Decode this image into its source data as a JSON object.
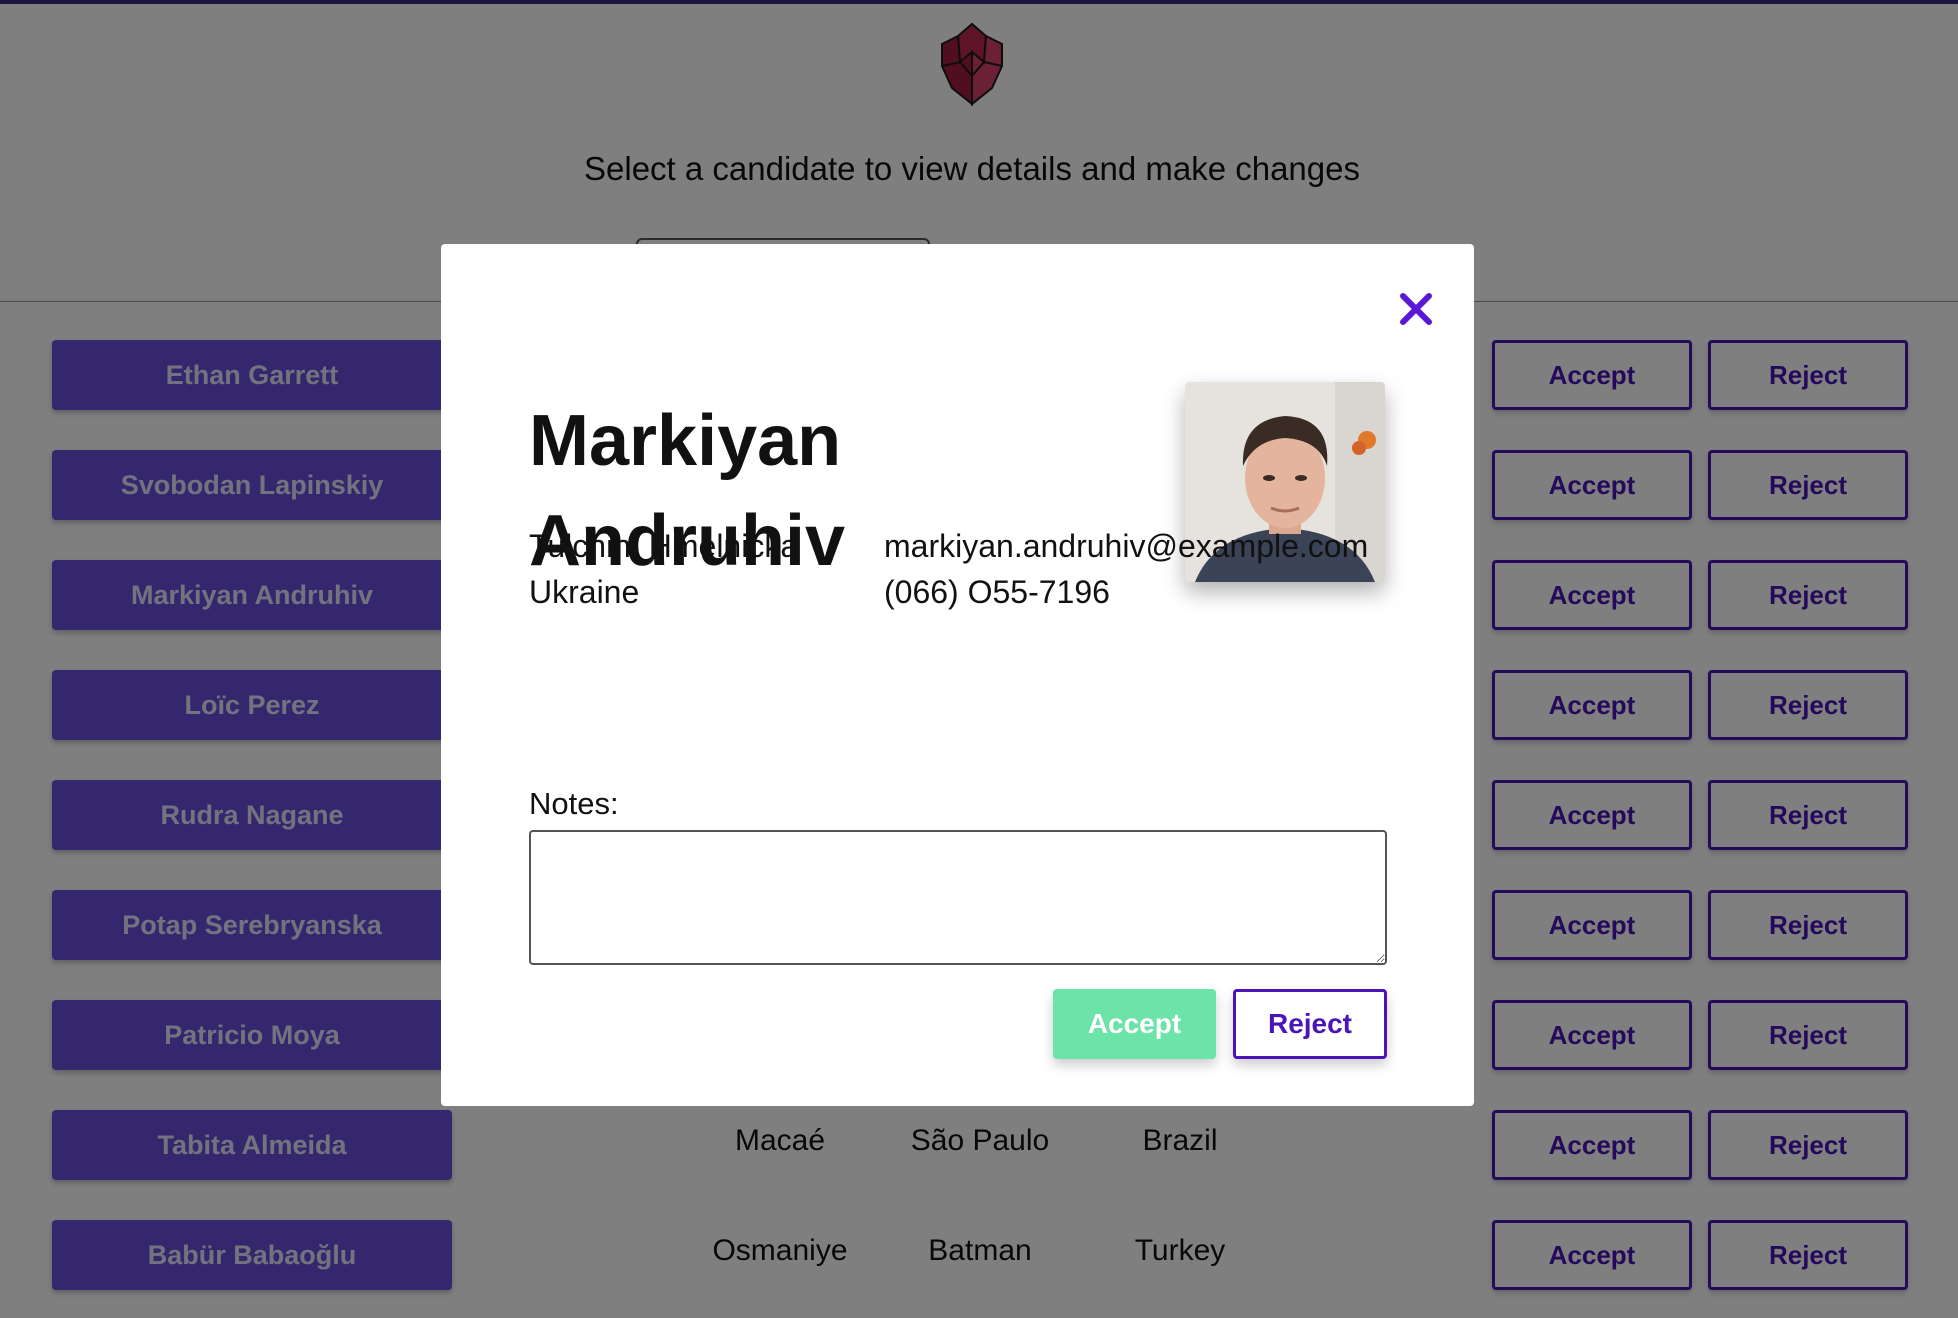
{
  "header": {
    "subtitle": "Select a candidate to view details and make changes",
    "search_placeholder": ""
  },
  "labels": {
    "accept": "Accept",
    "reject": "Reject"
  },
  "candidates": [
    {
      "name": "Ethan Garrett",
      "city": "",
      "state": "",
      "country": ""
    },
    {
      "name": "Svobodan Lapinskiy",
      "city": "",
      "state": "",
      "country": ""
    },
    {
      "name": "Markiyan Andruhiv",
      "city": "",
      "state": "",
      "country": ""
    },
    {
      "name": "Loïc Perez",
      "city": "",
      "state": "",
      "country": ""
    },
    {
      "name": "Rudra Nagane",
      "city": "",
      "state": "",
      "country": ""
    },
    {
      "name": "Potap Serebryanska",
      "city": "",
      "state": "",
      "country": ""
    },
    {
      "name": "Patricio Moya",
      "city": "",
      "state": "",
      "country": ""
    },
    {
      "name": "Tabita Almeida",
      "city": "Macaé",
      "state": "São Paulo",
      "country": "Brazil"
    },
    {
      "name": "Babür Babaoğlu",
      "city": "Osmaniye",
      "state": "Batman",
      "country": "Turkey"
    }
  ],
  "modal": {
    "first_name": "Markiyan",
    "last_name": "Andruhiv",
    "location_line1": "Tulchin, Hmelnicka",
    "location_line2": "Ukraine",
    "email": "markiyan.andruhiv@example.com",
    "phone": "(066) O55-7196",
    "notes_label": "Notes:",
    "notes_value": "",
    "accept_label": "Accept",
    "reject_label": "Reject",
    "close_icon": "close-icon"
  },
  "colors": {
    "primary_purple": "#6b4fdb",
    "outline_purple": "#4a14b8",
    "accept_green": "#6ce3a8",
    "logo_crimson": "#c0284f",
    "overlay": "rgba(0,0,0,0.5)"
  }
}
